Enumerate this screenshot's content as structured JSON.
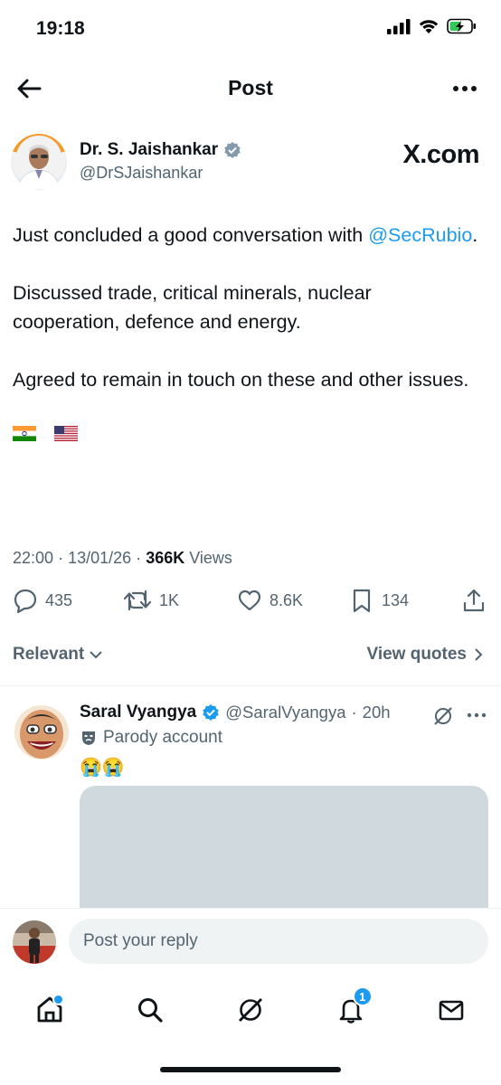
{
  "status_bar": {
    "time": "19:18"
  },
  "header": {
    "title": "Post"
  },
  "post": {
    "author_name": "Dr. S. Jaishankar",
    "author_handle": "@DrSJaishankar",
    "watermark": "X.com",
    "para1_text": "Just concluded a good conversation with",
    "para1_mention": "@SecRubio",
    "para1_end": ".",
    "para2": "Discussed trade, critical minerals, nuclear cooperation, defence and energy.",
    "para3": "Agreed to remain in touch on these and other issues.",
    "flags": [
      "india-flag",
      "usa-flag"
    ],
    "time": "22:00",
    "date": "13/01/26",
    "views_count": "366K",
    "views_label": "Views",
    "separator": "·"
  },
  "actions": {
    "replies": "435",
    "reposts": "1K",
    "likes": "8.6K",
    "bookmarks": "134"
  },
  "sort": {
    "relevant_label": "Relevant",
    "view_quotes_label": "View quotes"
  },
  "reply": {
    "author_name": "Saral Vyangya",
    "author_handle": "@SaralVyangya",
    "time": "20h",
    "separator": "·",
    "parody_label": "Parody account",
    "emojis": "😭😭"
  },
  "composer": {
    "placeholder": "Post your reply"
  },
  "tabbar": {
    "notifications_badge": "1"
  },
  "colors": {
    "accent": "#1d9bf0",
    "muted": "#536471",
    "text": "#0f1419"
  }
}
